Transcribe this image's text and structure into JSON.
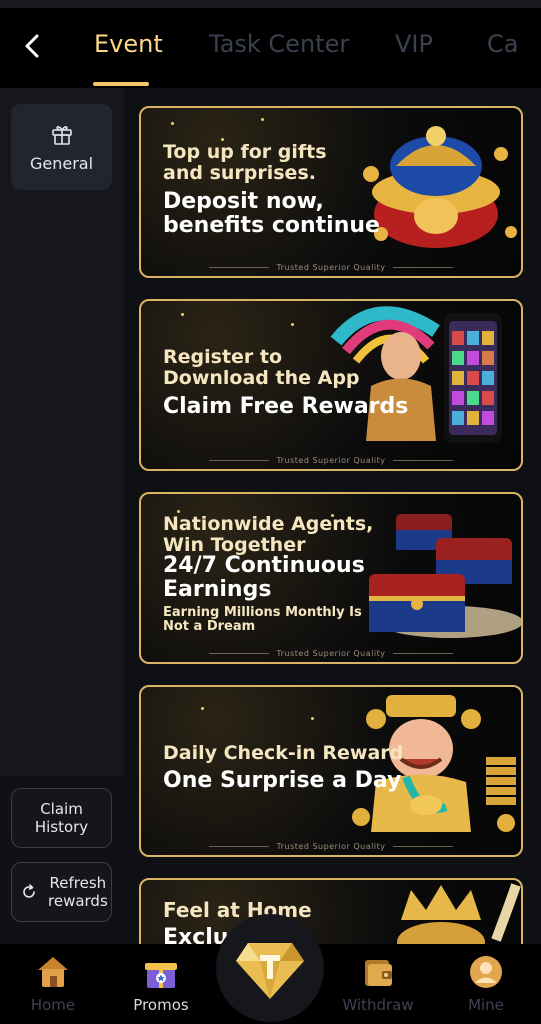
{
  "header": {
    "tabs": [
      {
        "label": "Event",
        "active": true
      },
      {
        "label": "Task Center",
        "active": false
      },
      {
        "label": "VIP",
        "active": false
      },
      {
        "label": "Ca",
        "active": false
      }
    ]
  },
  "sidebar": {
    "general_label": "General",
    "claim_history_label": "Claim\nHistory",
    "refresh_label": "Refresh\nrewards"
  },
  "banners": [
    {
      "title1": "Top up for gifts\nand surprises.",
      "title2": "Deposit now,\nbenefits continue",
      "footer": "Trusted Superior Quality"
    },
    {
      "title1": "Register to\nDownload the App",
      "title2": "Claim Free Rewards",
      "footer": "Trusted Superior Quality"
    },
    {
      "title1": "Nationwide Agents,\nWin Together",
      "title2": "24/7 Continuous\nEarnings",
      "title3": "Earning Millions Monthly Is\nNot a Dream",
      "footer": "Trusted Superior Quality"
    },
    {
      "title1": "Daily Check-in Reward",
      "title2": "One Surprise a Day",
      "footer": "Trusted Superior Quality"
    },
    {
      "title1": "Feel at Home",
      "title2": "Exclu        P Gift"
    }
  ],
  "bottom_nav": {
    "items": [
      {
        "label": "Home",
        "active": false
      },
      {
        "label": "Promos",
        "active": true
      },
      {
        "label": "Withdraw",
        "active": false
      },
      {
        "label": "Mine",
        "active": false
      }
    ]
  },
  "colors": {
    "accent": "#f3c56d",
    "active_tab": "#ffd58a",
    "inactive_tab": "#3c4150",
    "banner_border": "#d9b464"
  }
}
